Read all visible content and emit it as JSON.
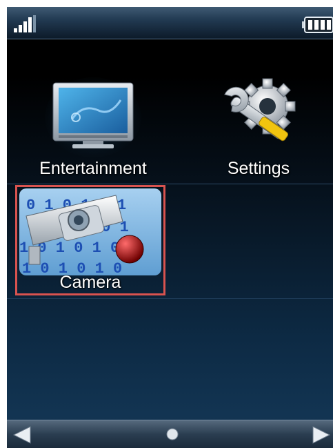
{
  "status_bar": {
    "signal_icon": "signal-strength-icon",
    "battery_icon": "battery-icon"
  },
  "apps": [
    {
      "label": "Entertainment",
      "icon": "tv-icon"
    },
    {
      "label": "Settings",
      "icon": "wrench-gear-icon"
    },
    {
      "label": "Camera",
      "icon": "security-camera-icon",
      "selected": true
    }
  ],
  "camera_icon_binary": [
    "0 1 0 1 0 1",
    "1 0 1 0 1",
    "1 0 1 0 1 0 1",
    "1 0 1 0 1 0"
  ],
  "nav": {
    "left_icon": "arrow-left-icon",
    "center_icon": "home-dot-icon",
    "right_icon": "arrow-right-icon"
  },
  "colors": {
    "selection_border": "#d9534f",
    "label_text": "#ffffff",
    "background_top": "#000000",
    "background_bottom": "#123452"
  }
}
